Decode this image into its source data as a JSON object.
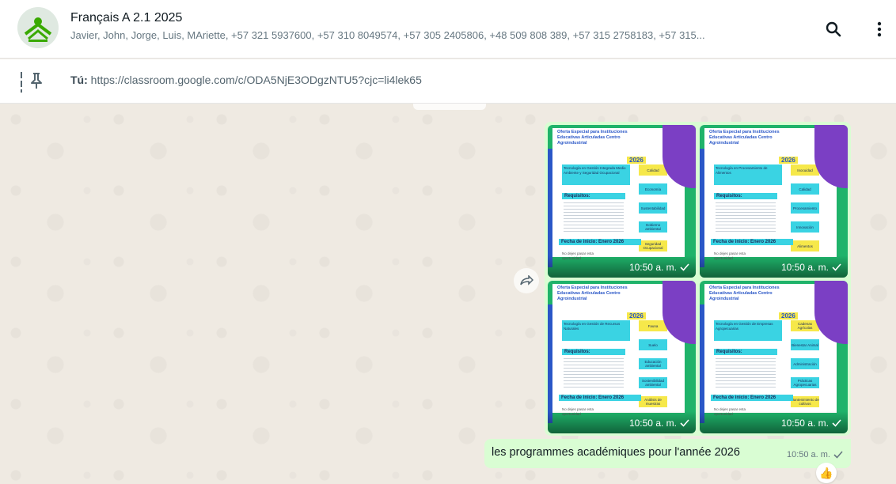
{
  "header": {
    "title": "Français A 2.1 2025",
    "members": "Javier, John, Jorge, Luis, MAriette, +57 321 5937600, +57 310 8049574, +57 305 2405806, +48 509 808 389, +57 315 2758183, +57 315...",
    "icons": [
      "search-icon",
      "menu-icon"
    ]
  },
  "pinned": {
    "sender": "Tú:",
    "text": " https://classroom.google.com/c/ODA5NjE3ODgzNTU5?cjc=li4lek65"
  },
  "album": {
    "images": [
      {
        "time": "10:50 a. m.",
        "title": "Oferta Especial para Instituciones Educativas Articuladas Centro Agroindustrial",
        "year": "2026",
        "program": "Tecnología en Gestión Integrada Medio Ambiente y Seguridad Ocupacional",
        "tags": [
          "Calidad",
          "Economía",
          "Sustentabilidad",
          "Gobierno ambiental",
          "Seguridad Ocupacional"
        ],
        "requirements": "Requisitos:",
        "start": "Fecha de inicio: Enero 2026",
        "slogan": "No dejes pasar esta oportunidad"
      },
      {
        "time": "10:50 a. m.",
        "title": "Oferta Especial para Instituciones Educativas Articuladas Centro Agroindustrial",
        "year": "2026",
        "program": "Tecnología en Procesamiento de Alimentos",
        "tags": [
          "Inocuidad",
          "Calidad",
          "Procesamiento",
          "Innovación",
          "Alimentos"
        ],
        "requirements": "Requisitos:",
        "start": "Fecha de inicio: Enero 2026",
        "slogan": "No dejes pasar esta oportunidad"
      },
      {
        "time": "10:50 a. m.",
        "title": "Oferta Especial para Instituciones Educativas Articuladas Centro Agroindustrial",
        "year": "2026",
        "program": "Tecnología en Gestión de Recursos Naturales",
        "tags": [
          "Fauna",
          "Suelo",
          "Educación ambiental",
          "Sostenibilidad ambiental",
          "Análisis de muestras"
        ],
        "requirements": "Requisitos:",
        "start": "Fecha de inicio: Enero 2026",
        "slogan": "No dejes pasar esta oportunidad"
      },
      {
        "time": "10:50 a. m.",
        "title": "Oferta Especial para Instituciones Educativas Articuladas Centro Agroindustrial",
        "year": "2026",
        "program": "Tecnología en Gestión de Empresas Agropecuarias",
        "tags": [
          "Cadenas Agrícolas",
          "Bienestar Animal",
          "Administración",
          "Prácticas Agropecuarias",
          "Mantenimiento de cultivos"
        ],
        "requirements": "Requisitos:",
        "start": "Fecha de inicio: Enero 2026",
        "slogan": "No dejes pasar esta oportunidad"
      }
    ]
  },
  "message": {
    "text": "les programmes académiques pour l'année 2026",
    "time": "10:50 a. m."
  },
  "reaction": "👍",
  "colors": {
    "outgoing_bubble": "#d9fdd3",
    "chat_background": "#efeae2",
    "poster_green": "#1fb36a",
    "poster_cyan": "#3ad3e3",
    "poster_yellow": "#f6e84a",
    "poster_purple": "#7b3fc4"
  }
}
